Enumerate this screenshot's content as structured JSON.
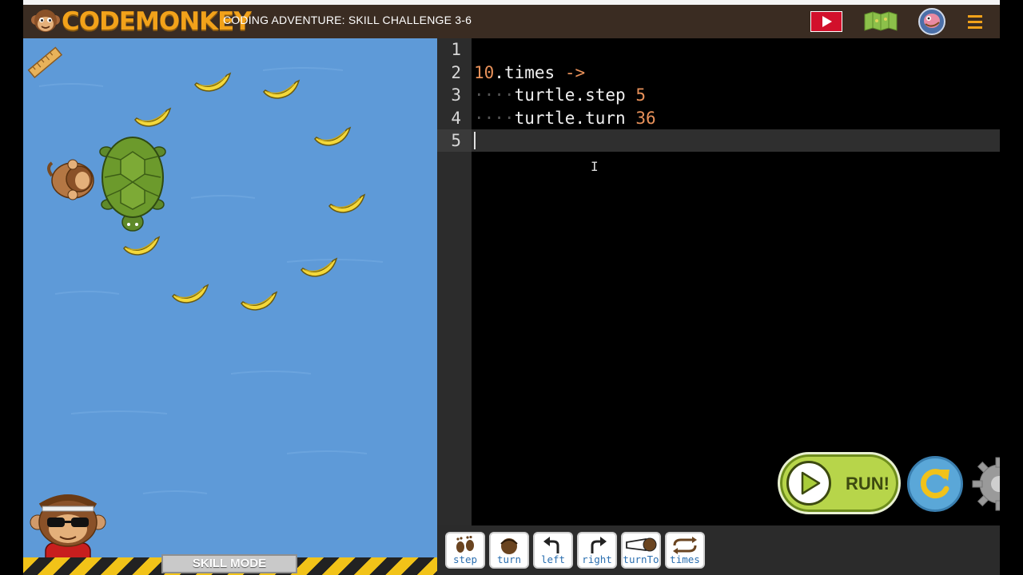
{
  "header": {
    "logo_text": "CODEMONKEY",
    "title": "CODING ADVENTURE: SKILL CHALLENGE 3-6",
    "icons": [
      "video-play-icon",
      "map-icon",
      "avatar-icon",
      "hamburger-menu-icon"
    ]
  },
  "game": {
    "mode_label": "SKILL MODE",
    "banana_count": 10,
    "icons": [
      "ruler-icon",
      "turtle",
      "monkey",
      "banana",
      "coach-character"
    ]
  },
  "editor": {
    "line_numbers": [
      "1",
      "2",
      "3",
      "4",
      "5"
    ],
    "line2": {
      "number": "10",
      "method": ".times",
      "arrow": "->"
    },
    "line3": {
      "indent": "····",
      "code": "turtle.step",
      "arg": "5"
    },
    "line4": {
      "indent": "····",
      "code": "turtle.turn",
      "arg": "36"
    },
    "active_line": 5
  },
  "controls": {
    "run_label": "RUN!",
    "icons": [
      "run-play-icon",
      "reset-icon",
      "settings-gear-icon"
    ]
  },
  "palette": {
    "buttons": [
      {
        "label": "step",
        "icon": "footprints-icon"
      },
      {
        "label": "turn",
        "icon": "turtle-turn-icon"
      },
      {
        "label": "left",
        "icon": "arrow-left-turn-icon"
      },
      {
        "label": "right",
        "icon": "arrow-right-turn-icon"
      },
      {
        "label": "turnTo",
        "icon": "telescope-icon"
      },
      {
        "label": "times",
        "icon": "loop-icon"
      }
    ]
  },
  "colors": {
    "header_bg": "#3a2c22",
    "logo_orange": "#f2a21a",
    "water": "#5e9ad8",
    "run_green": "#b7d54a",
    "reset_blue": "#5aa7d8",
    "code_number": "#e8915a",
    "palette_label": "#2b6fb0"
  }
}
